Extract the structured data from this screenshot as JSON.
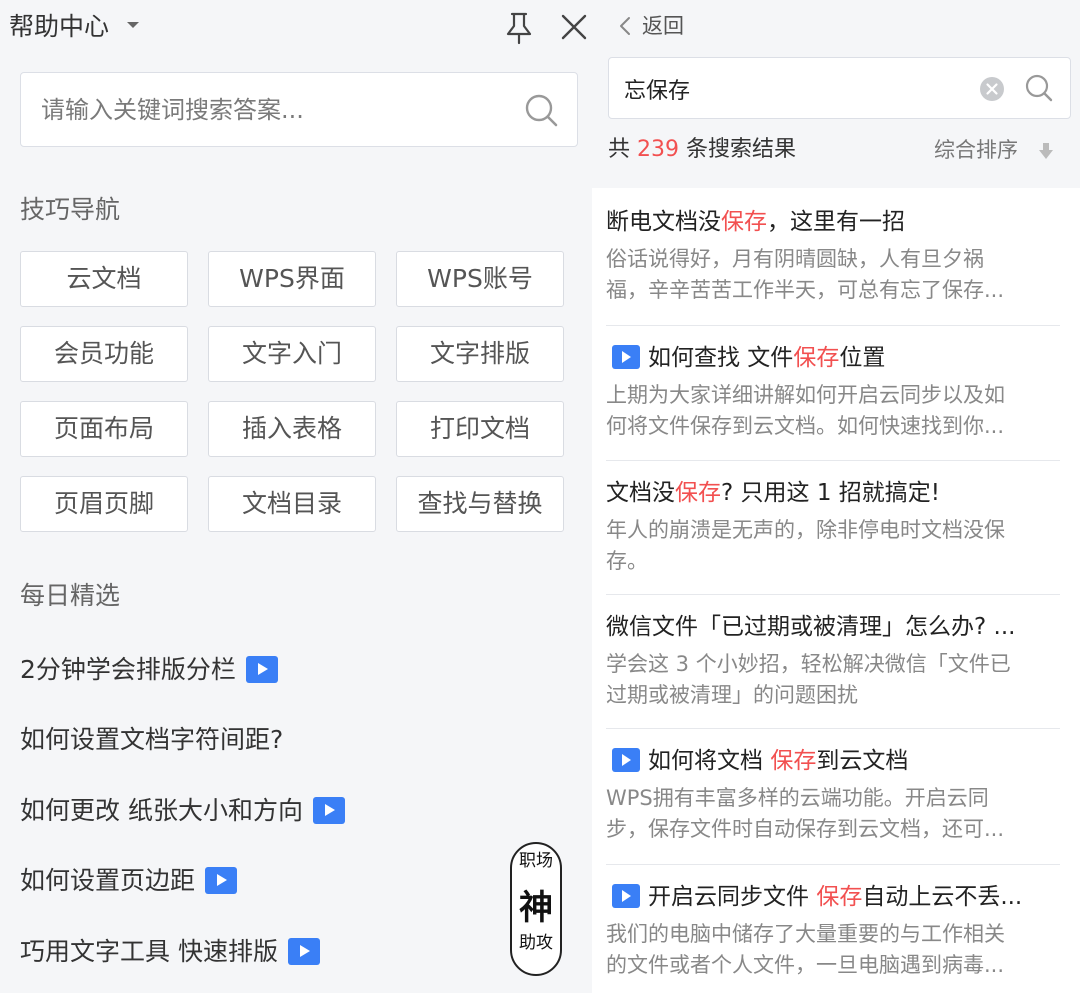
{
  "left_panel": {
    "title": "帮助中心",
    "search": {
      "placeholder": "请输入关键词搜索答案..."
    },
    "nav_section_title": "技巧导航",
    "nav_tags": [
      "云文档",
      "WPS界面",
      "WPS账号",
      "会员功能",
      "文字入门",
      "文字排版",
      "页面布局",
      "插入表格",
      "打印文档",
      "页眉页脚",
      "文档目录",
      "查找与替换"
    ],
    "daily_section_title": "每日精选",
    "daily_items": [
      {
        "text": "2分钟学会排版分栏",
        "video": true
      },
      {
        "text": "如何设置文档字符间距?",
        "video": false
      },
      {
        "text": "如何更改 纸张大小和方向",
        "video": true
      },
      {
        "text": "如何设置页边距",
        "video": true
      },
      {
        "text": "巧用文字工具 快速排版",
        "video": true
      }
    ],
    "seal": {
      "top": "职场",
      "middle": "神",
      "bottom": "助攻"
    }
  },
  "right_panel": {
    "back_label": "返回",
    "search_value": "忘保存",
    "result_prefix": "共",
    "result_count": "239",
    "result_suffix": "条搜索结果",
    "sort_label": "综合排序",
    "results": [
      {
        "video": false,
        "title_before": "断电文档没",
        "title_highlight": "保存",
        "title_after": "，这里有一招",
        "snippet": [
          "俗话说得好，月有阴晴圆缺，人有旦夕祸",
          "福，辛辛苦苦工作半天，可总有忘了保存..."
        ]
      },
      {
        "video": true,
        "title_before": "如何查找 文件",
        "title_highlight": "保存",
        "title_after": "位置",
        "snippet": [
          "上期为大家详细讲解如何开启云同步以及如",
          "何将文件保存到云文档。如何快速找到你..."
        ]
      },
      {
        "video": false,
        "title_before": "文档没",
        "title_highlight": "保存",
        "title_after": "? 只用这 1 招就搞定!",
        "snippet": [
          "年人的崩溃是无声的，除非停电时文档没保",
          "存。"
        ]
      },
      {
        "video": false,
        "title_before": "微信文件「已过期或被清理」怎么办? ...",
        "title_highlight": "",
        "title_after": "",
        "snippet": [
          "学会这 3 个小妙招，轻松解决微信「文件已",
          "过期或被清理」的问题困扰"
        ]
      },
      {
        "video": true,
        "title_before": "如何将文档 ",
        "title_highlight": "保存",
        "title_after": "到云文档",
        "snippet": [
          "WPS拥有丰富多样的云端功能。开启云同",
          "步，保存文件时自动保存到云文档，还可..."
        ]
      },
      {
        "video": true,
        "title_before": "开启云同步文件 ",
        "title_highlight": "保存",
        "title_after": "自动上云不丢...",
        "snippet": [
          "我们的电脑中储存了大量重要的与工作相关",
          "的文件或者个人文件，一旦电脑遇到病毒..."
        ]
      }
    ]
  },
  "colors": {
    "accent": "#3a7ff6",
    "highlight": "#f25050",
    "panel_bg": "#f5f6f8"
  },
  "icons": [
    "pin-icon",
    "close-icon",
    "search-icon",
    "chevron-left-icon",
    "clear-icon",
    "sort-down-icon",
    "play-icon",
    "caret-down-icon"
  ]
}
